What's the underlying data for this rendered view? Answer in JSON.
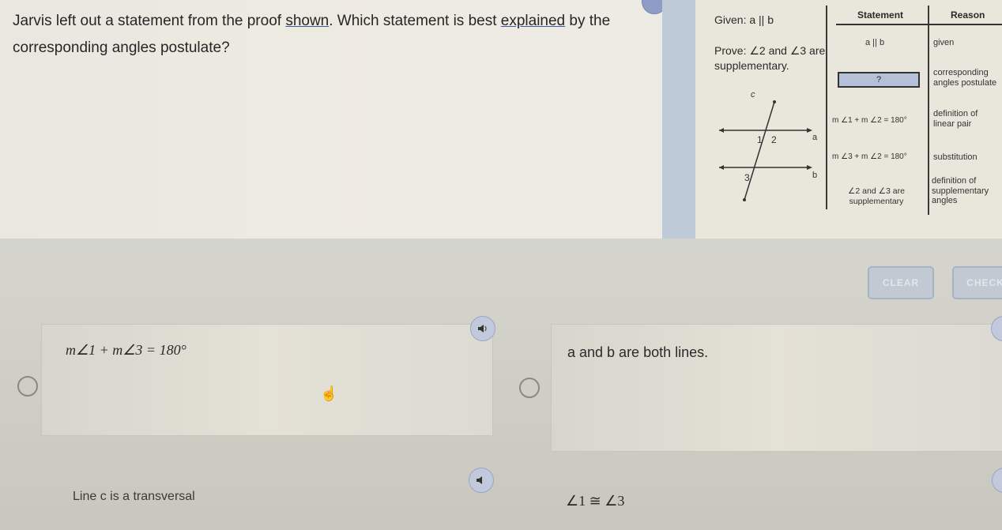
{
  "question": {
    "part1": "Jarvis left out a statement from the proof ",
    "link1": "shown",
    "part2": ". Which statement is best ",
    "link2": "explained",
    "part3": " by the corresponding angles postulate?"
  },
  "proof": {
    "given": "Given: a || b",
    "prove": "Prove: ∠2 and ∠3 are supplementary.",
    "diagram_labels": {
      "transversal": "c",
      "line_a": "a",
      "line_b": "b",
      "angle1": "1",
      "angle2": "2",
      "angle3": "3"
    },
    "table": {
      "headers": {
        "statement": "Statement",
        "reason": "Reason"
      },
      "rows": [
        {
          "statement": "a || b",
          "reason": "given"
        },
        {
          "statement": "?",
          "reason": "corresponding angles postulate"
        },
        {
          "statement": "m ∠1 + m ∠2 = 180°",
          "reason": "definition of linear pair"
        },
        {
          "statement": "m ∠3 + m ∠2 = 180°",
          "reason": "substitution"
        },
        {
          "statement": "∠2 and ∠3 are supplementary",
          "reason": "definition of supplementary angles"
        }
      ]
    }
  },
  "buttons": {
    "clear": "CLEAR",
    "check": "CHECK"
  },
  "choices": [
    {
      "text": "m∠1 + m∠3 = 180°",
      "icon": "speaker-icon"
    },
    {
      "text": "a and b are both lines.",
      "icon": "speaker-icon"
    },
    {
      "text": "Line c is a transversal",
      "icon": "speaker-icon"
    },
    {
      "text": "∠1 ≅ ∠3",
      "icon": "speaker-icon"
    }
  ]
}
